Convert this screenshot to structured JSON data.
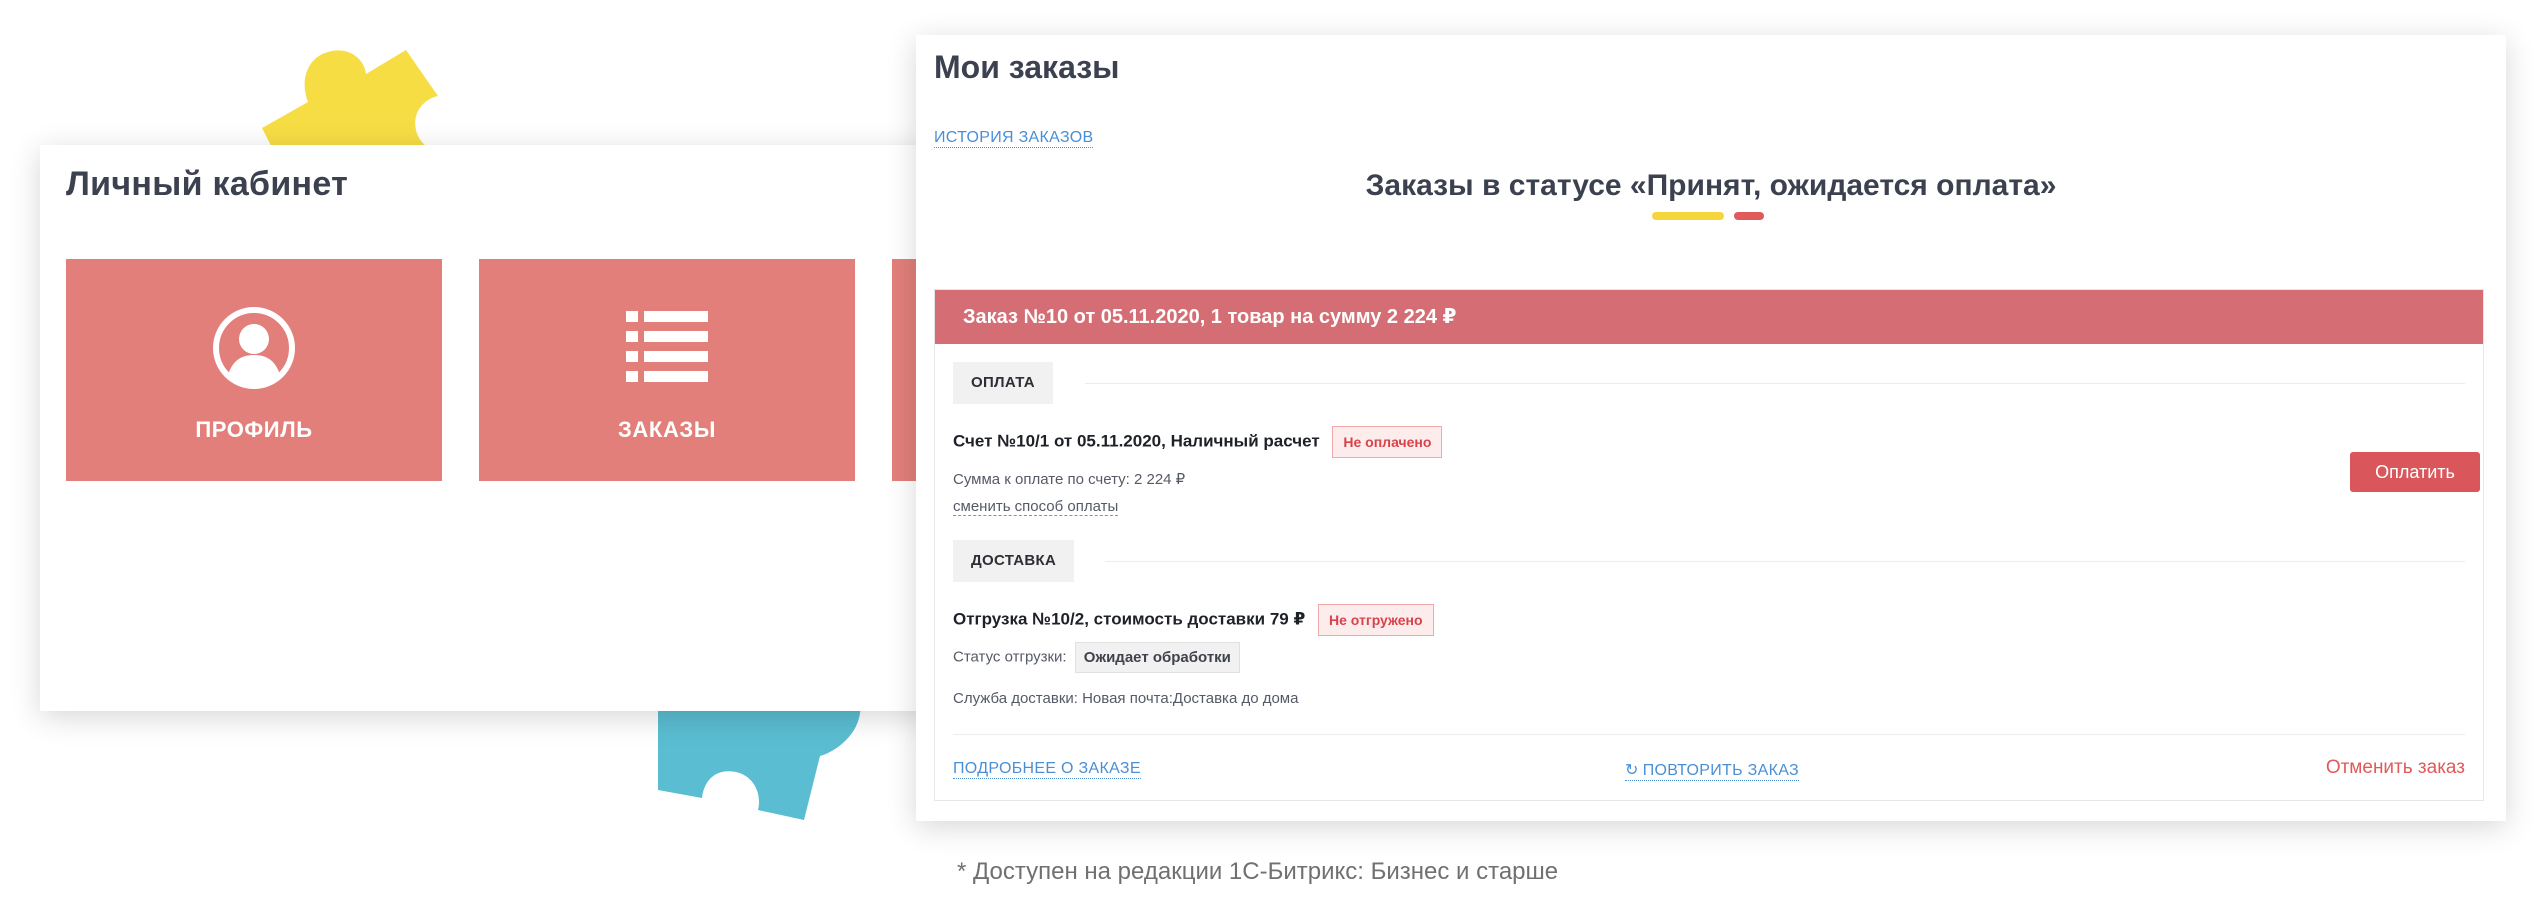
{
  "colors": {
    "tile": "#e27f7a",
    "order_header": "#d46e74",
    "accent_yellow": "#f5d73b",
    "accent_red": "#e05a5a",
    "link": "#4a8fd6",
    "puzzle_yellow": "#f7dd44",
    "puzzle_blue": "#5bbdd2"
  },
  "cabinet": {
    "title": "Личный кабинет",
    "tiles": [
      {
        "label": "ПРОФИЛЬ",
        "icon": "user-circle-icon"
      },
      {
        "label": "ЗАКАЗЫ",
        "icon": "list-icon"
      }
    ]
  },
  "orders": {
    "title": "Мои заказы",
    "history_link": "ИСТОРИЯ ЗАКАЗОВ",
    "status_heading": "Заказы в статусе «Принят, ожидается оплата»",
    "order": {
      "header": "Заказ №10 от 05.11.2020, 1 товар на сумму 2 224 ₽",
      "payment": {
        "section_label": "ОПЛАТА",
        "invoice": "Счет №10/1 от 05.11.2020, Наличный расчет",
        "invoice_status": "Не оплачено",
        "amount_text": "Сумма к оплате по счету: 2 224 ₽",
        "change_method": "сменить способ оплаты",
        "pay_button": "Оплатить"
      },
      "delivery": {
        "section_label": "ДОСТАВКА",
        "shipment": "Отгрузка №10/2, стоимость доставки 79 ₽",
        "shipment_status": "Не отгружено",
        "status_label": "Статус отгрузки:",
        "status_value": "Ожидает обработки",
        "service_text": "Служба доставки: Новая почта:Доставка до дома"
      },
      "footer": {
        "details_link": "ПОДРОБНЕЕ О ЗАКАЗЕ",
        "repeat_link": "ПОВТОРИТЬ ЗАКАЗ",
        "repeat_icon": "refresh-icon",
        "cancel_link": "Отменить заказ"
      }
    }
  },
  "footnote": "* Доступен на редакции 1С-Битрикс: Бизнес и старше"
}
